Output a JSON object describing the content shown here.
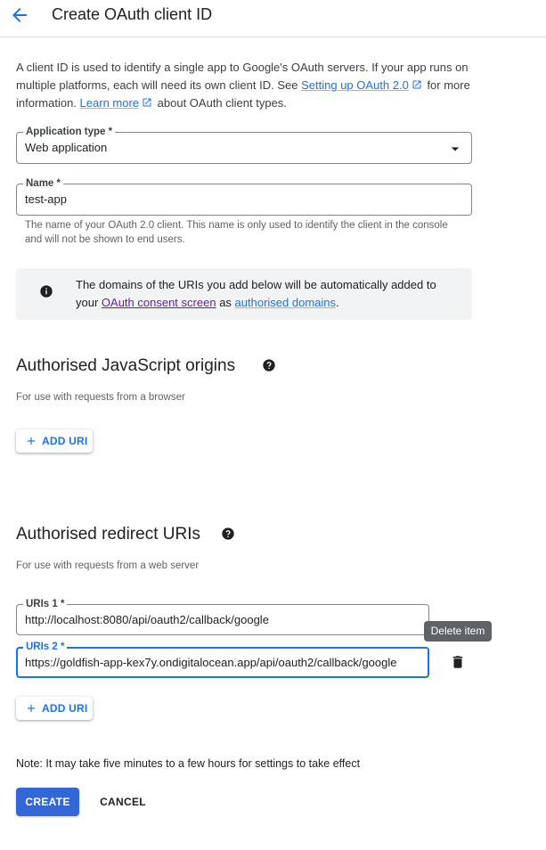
{
  "header": {
    "title": "Create OAuth client ID"
  },
  "intro": {
    "text1": "A client ID is used to identify a single app to Google's OAuth servers. If your app runs on multiple platforms, each will need its own client ID. See",
    "link1": "Setting up OAuth 2.0",
    "text2": "for more information.",
    "link2": "Learn more",
    "text3": "about OAuth client types."
  },
  "app_type": {
    "label": "Application type *",
    "value": "Web application"
  },
  "name_field": {
    "label": "Name *",
    "value": "test-app",
    "helper": "The name of your OAuth 2.0 client. This name is only used to identify the client in the console and will not be shown to end users."
  },
  "info": {
    "text1": "The domains of the URIs you add below will be automatically added to your",
    "link1": "OAuth consent screen",
    "text2": "as",
    "link2": "authorised domains",
    "text3": "."
  },
  "js_origins": {
    "title": "Authorised JavaScript origins",
    "subtitle": "For use with requests from a browser",
    "add_label": "ADD URI"
  },
  "redirect": {
    "title": "Authorised redirect URIs",
    "subtitle": "For use with requests from a web server",
    "uris": [
      {
        "label": "URIs 1 *",
        "value": "http://localhost:8080/api/oauth2/callback/google"
      },
      {
        "label": "URIs 2 *",
        "value": "https://goldfish-app-kex7y.ondigitalocean.app/api/oauth2/callback/google"
      }
    ],
    "tooltip": "Delete item",
    "add_label": "ADD URI"
  },
  "note": "Note: It may take five minutes to a few hours for settings to take effect",
  "buttons": {
    "create": "CREATE",
    "cancel": "CANCEL"
  },
  "colors": {
    "accent": "#1a73e8",
    "primary_button": "#3367d6",
    "focus": "#1a73e8",
    "visited_link": "#681da8"
  }
}
